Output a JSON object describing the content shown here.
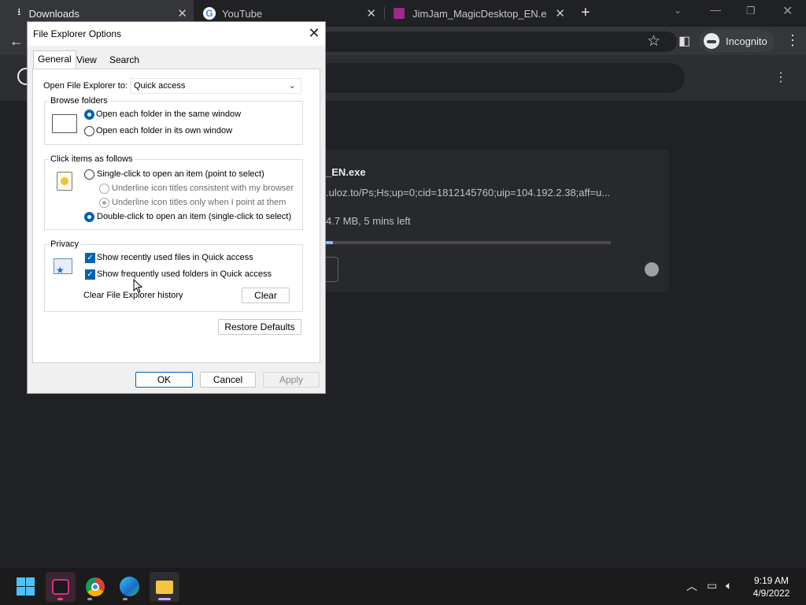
{
  "browser": {
    "tabs": [
      {
        "title": "Downloads",
        "icon": "download-icon"
      },
      {
        "title": "YouTube",
        "icon": "google-icon"
      },
      {
        "title": "JimJam_MagicDesktop_EN.exe | U",
        "icon": "site-icon"
      }
    ],
    "new_tab": "+",
    "incognito_label": "Incognito"
  },
  "downloads": {
    "filename_partial": "_EN.exe",
    "url_partial": ".uloz.to/Ps;Hs;up=0;cid=1812145760;uip=104.192.2.38;aff=u...",
    "status_partial": "4.7 MB, 5 mins left",
    "progress": 0.03
  },
  "dialog": {
    "title": "File Explorer Options",
    "close": "✕",
    "tabs": [
      "General",
      "View",
      "Search"
    ],
    "active_tab": "General",
    "open_to_label": "Open File Explorer to:",
    "open_to_value": "Quick access",
    "browse_folders": {
      "title": "Browse folders",
      "option_same": "Open each folder in the same window",
      "option_own": "Open each folder in its own window",
      "selected": "same"
    },
    "click_items": {
      "title": "Click items as follows",
      "single_click": "Single-click to open an item (point to select)",
      "underline_browser": "Underline icon titles consistent with my browser",
      "underline_point": "Underline icon titles only when I point at them",
      "double_click": "Double-click to open an item (single-click to select)",
      "selected": "double"
    },
    "privacy": {
      "title": "Privacy",
      "show_recent_files": "Show recently used files in Quick access",
      "show_frequent_folders": "Show frequently used folders in Quick access",
      "clear_history_label": "Clear File Explorer history",
      "clear_button": "Clear"
    },
    "restore_defaults": "Restore Defaults",
    "ok": "OK",
    "cancel": "Cancel",
    "apply": "Apply"
  },
  "taskbar": {
    "time": "9:19 AM",
    "date": "4/9/2022"
  },
  "colors": {
    "accent": "#0063b1",
    "progress": "#8ab4f8",
    "chrome_dark": "#202124"
  }
}
